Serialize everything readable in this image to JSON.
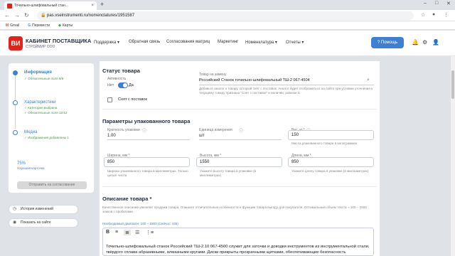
{
  "browser": {
    "tab_title": "Точильно-шлифовальный стан...",
    "tab_close": "×",
    "new_tab": "+",
    "url": "pas.vseinstrumenti.ru/nomenclatures/1951587",
    "bookmarks": [
      {
        "label": "Gmail"
      },
      {
        "label": "Перевести"
      },
      {
        "label": "Карты"
      }
    ]
  },
  "header": {
    "logo": "ВИ",
    "brand_title": "КАБИНЕТ ПОСТАВЩИКА",
    "brand_sub": "СТРОЙМИР ООО",
    "menu": [
      {
        "label": "Поддержка ▾"
      },
      {
        "label": "Обратная связь"
      },
      {
        "label": "Согласования матриц"
      },
      {
        "label": "Маркетинг"
      },
      {
        "label": "Номенклатура ▾"
      },
      {
        "label": "Отчеты ▾"
      }
    ],
    "help_label": "? Помощь"
  },
  "sidebar": {
    "steps": [
      {
        "title": "Информация",
        "sub1": "✓ Обязательные поля 9/9",
        "sub2": ""
      },
      {
        "title": "Характеристики",
        "sub1": "✓ Категория выбрана",
        "sub2": "✓ Обязательные поля 12/12"
      },
      {
        "title": "Медиа",
        "sub1": "✓ Изображения добавлены 1",
        "sub2": ""
      }
    ],
    "progress_percent": 75,
    "progress_label": "75%",
    "progress_caption": "Хорошая карточка",
    "send_label": "Отправить на согласование",
    "history_label": "История изменений",
    "show_site_label": "Показать на сайте"
  },
  "status": {
    "heading": "Статус товара",
    "activity_label": "Активность",
    "off_label": "Нет",
    "on_label": "Да",
    "snyat_label": "Снят с поставок",
    "replace_label": "Товар на замену",
    "replace_value": "Российский Станок точильно-шлифовальный ТШ-2 067-4504",
    "replace_hint": "Добавьте аналог к товару, который снят с поставок. Аналог будет отображаться на сайте при условии уточнения к текущему товару признака \"Снят с поставок\" и наличии, равном 0."
  },
  "pack": {
    "heading": "Параметры упакованного товара",
    "multiplicity_label": "Кратность упаковки",
    "multiplicity_value": "1.00",
    "unit_label": "Единица измерения",
    "unit_value": "шт",
    "weight_label": "Вес, кг *",
    "weight_value": "150",
    "weight_hint": "Масса упакованного товара в килограммах",
    "width_label": "Ширина, мм *",
    "width_value": "850",
    "width_hint": "Ширина упакованного товара в миллиметрах. Только целые числа",
    "height_label": "Высота, мм *",
    "height_value": "1550",
    "height_hint": "Укажите высоту товара в упаковке (в миллиметрах)",
    "length_label": "Длина, мм *",
    "length_value": "850",
    "length_hint": "Укажите длину товара в упаковке (в миллиметрах)"
  },
  "description": {
    "heading": "Описание товара *",
    "hint": "Качественное описание увеличит продажи товара. Опишите отличительные особенности и функции товара выгоду для покупателя. Оптимальный объем текста ~ 100 – 1500 знаков с пробелами.",
    "counter": "Необходимый диапазон: 150 – 1500 (Сейчас: 445)",
    "text": "Точильно-шлифовальный станок Российский ТШ-2.10 067-4500 служит для заточки и доводки инструментов из инструментальной стали, твёрдого сплава абразивными, алмазными кругами. Диски прикрыты прозрачными щитками, обеспечивающие безопасность"
  },
  "colors": {
    "accent": "#3d7fd1",
    "success": "#3d9b3d",
    "brand": "#e2231a"
  }
}
